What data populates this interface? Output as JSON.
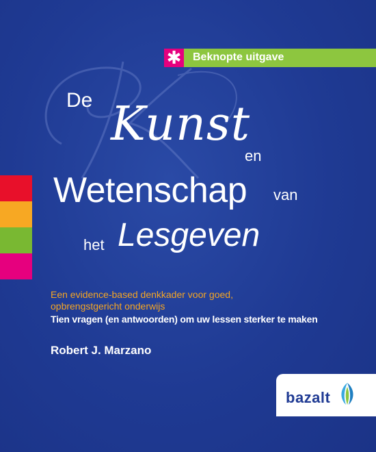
{
  "badge": {
    "asterisk": "✱",
    "label": "Beknopte uitgave",
    "colors": {
      "bar": "#8dc63f",
      "asterisk_bg": "#e6007e"
    }
  },
  "title": {
    "de": "De",
    "kunst": "Kunst",
    "en": "en",
    "wetenschap": "Wetenschap",
    "van": "van",
    "het": "het",
    "lesgeven": "Lesgeven"
  },
  "subtitle": {
    "line1": "Een evidence-based denkkader voor goed,",
    "line2": "opbrengstgericht onderwijs"
  },
  "tagline": "Tien vragen (en antwoorden) om uw lessen sterker te maken",
  "author": "Robert J. Marzano",
  "publisher": {
    "name": "bazalt",
    "logo_icon": "leaf-logo-icon"
  },
  "stripes": [
    "#e8102a",
    "#f7a823",
    "#79b832",
    "#e6007e"
  ],
  "colors": {
    "background": "#1f3a93",
    "subtitle": "#f6a623",
    "text": "#ffffff"
  }
}
